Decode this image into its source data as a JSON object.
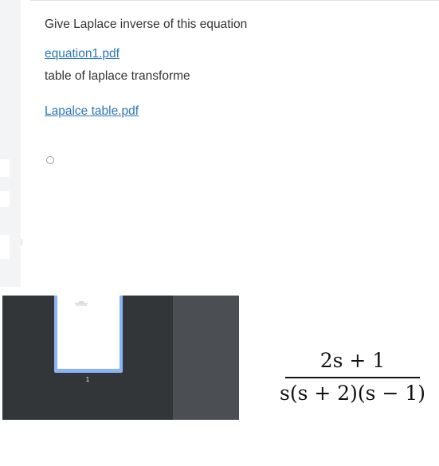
{
  "question": {
    "text": "Give Laplace inverse of this equation",
    "attachment_1": "equation1.pdf",
    "note": "table of laplace transforme",
    "attachment_2": "Lapalce table.pdf"
  },
  "pdf_viewer": {
    "page_number": "1"
  },
  "equation": {
    "numerator": "2s + 1",
    "denominator": "s(s + 2)(s − 1)"
  },
  "colors": {
    "link": "#2a78b9",
    "viewer_sidebar": "#323639",
    "viewer_main": "#4b4f53",
    "thumbnail_highlight": "#8ab4f8"
  },
  "icons": [
    "radio-option-icon"
  ]
}
